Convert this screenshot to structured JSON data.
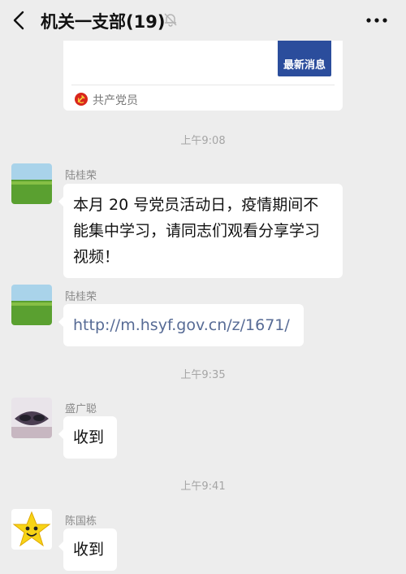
{
  "header": {
    "title": "机关一支部(19)"
  },
  "card": {
    "thumb_text": "最新消息",
    "source": "共产党员"
  },
  "messages": [
    {
      "time": "上午9:08",
      "sender": "陆桂荣",
      "text": "本月 20 号党员活动日，疫情期间不能集中学习，请同志们观看分享学习视频！"
    },
    {
      "sender": "陆桂荣",
      "text": "http://m.hsyf.gov.cn/z/1671/"
    },
    {
      "time": "上午9:35",
      "sender": "盛广聪",
      "text": "收到"
    },
    {
      "time": "上午9:41",
      "sender": "陈国栋",
      "text": "收到"
    }
  ],
  "colors": {
    "background": "#ededed",
    "bubble": "#ffffff",
    "link": "#576b95",
    "thumb": "#2b4d9c"
  },
  "icons": [
    "back-icon",
    "mute-bell-icon",
    "more-icon",
    "party-emblem-icon"
  ]
}
